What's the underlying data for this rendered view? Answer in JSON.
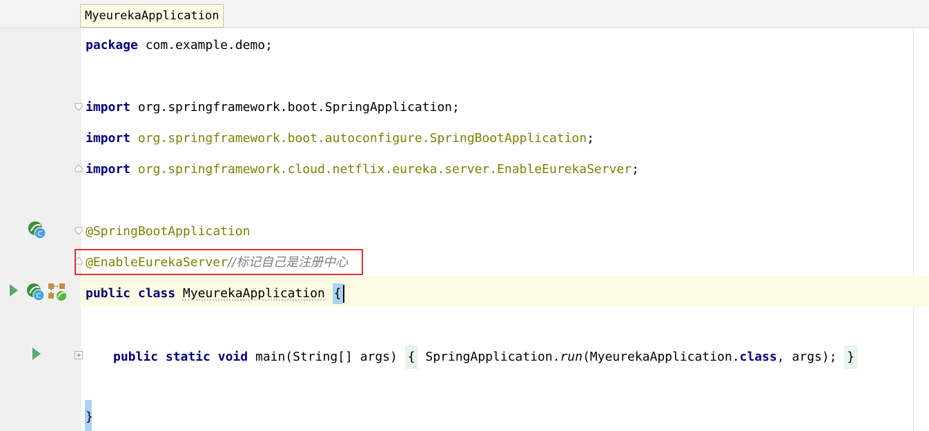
{
  "editor": {
    "tab_label": "MyeurekaApplication",
    "lines": {
      "package_kw": "package",
      "package_name": " com.example.demo;",
      "import1_kw": "import",
      "import1_path": " org.springframework.boot.SpringApplication;",
      "import2_kw": "import",
      "import2_path": " org.springframework.boot.autoconfigure.SpringBootApplication",
      "import2_semicolon": ";",
      "import3_kw": "import",
      "import3_path": " org.springframework.cloud.netflix.eureka.server.EnableEurekaServer",
      "import3_semicolon": ";",
      "annotation1": "@SpringBootApplication",
      "annotation2": "@EnableEurekaServer",
      "comment": "//标记自己是注册中心",
      "class_public": "public",
      "class_kw": "class",
      "class_name": "MyeurekaApplication",
      "class_brace": "{",
      "main_public": "public",
      "main_static": "static",
      "main_void": "void",
      "main_sig": " main(String[] args) ",
      "main_open": "{",
      "main_body1": " SpringApplication.",
      "main_run": "run",
      "main_body2": "(MyeurekaApplication.",
      "main_class_kw": "class",
      "main_body3": ", args); ",
      "main_close": "}",
      "closing_brace": "}"
    }
  },
  "colors": {
    "keyword": "#000080",
    "annotation": "#808000",
    "comment": "#808080",
    "highlight_box": "#e03030",
    "caret_row": "#fffae3"
  }
}
